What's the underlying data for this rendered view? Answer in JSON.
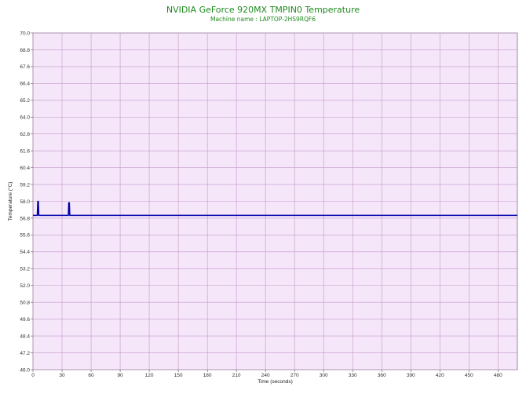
{
  "chart_data": {
    "type": "line",
    "title": "NVIDIA GeForce 920MX TMPIN0 Temperature",
    "subtitle": "Machine name : LAPTOP-2HS9RQF6",
    "xlabel": "Time (seconds)",
    "ylabel": "Temperature (°C)",
    "xlim": [
      0,
      500
    ],
    "ylim": [
      46.0,
      70.0
    ],
    "x_ticks": [
      0,
      30,
      60,
      90,
      120,
      150,
      180,
      210,
      240,
      270,
      300,
      330,
      360,
      390,
      420,
      450,
      480
    ],
    "y_ticks": [
      "46.0",
      "47.2",
      "48.4",
      "49.6",
      "50.8",
      "52.0",
      "53.2",
      "54.4",
      "55.6",
      "56.8",
      "58.0",
      "59.2",
      "60.4",
      "61.6",
      "62.8",
      "64.0",
      "65.2",
      "66.4",
      "67.6",
      "68.8",
      "70.0"
    ],
    "grid": true,
    "colors": {
      "plot_background": "#f5e6fa",
      "grid": "#c49ac8",
      "line": "#0000aa",
      "title": "#1f8a1f"
    },
    "series": [
      {
        "x": [
          0,
          4.5,
          5,
          5.5,
          6,
          6.5,
          7,
          36.5,
          37,
          37.5,
          38,
          500
        ],
        "y": [
          57.0,
          57.0,
          58.0,
          58.0,
          57.0,
          57.0,
          57.0,
          57.0,
          57.9,
          57.9,
          57.0,
          57.0
        ]
      }
    ]
  }
}
